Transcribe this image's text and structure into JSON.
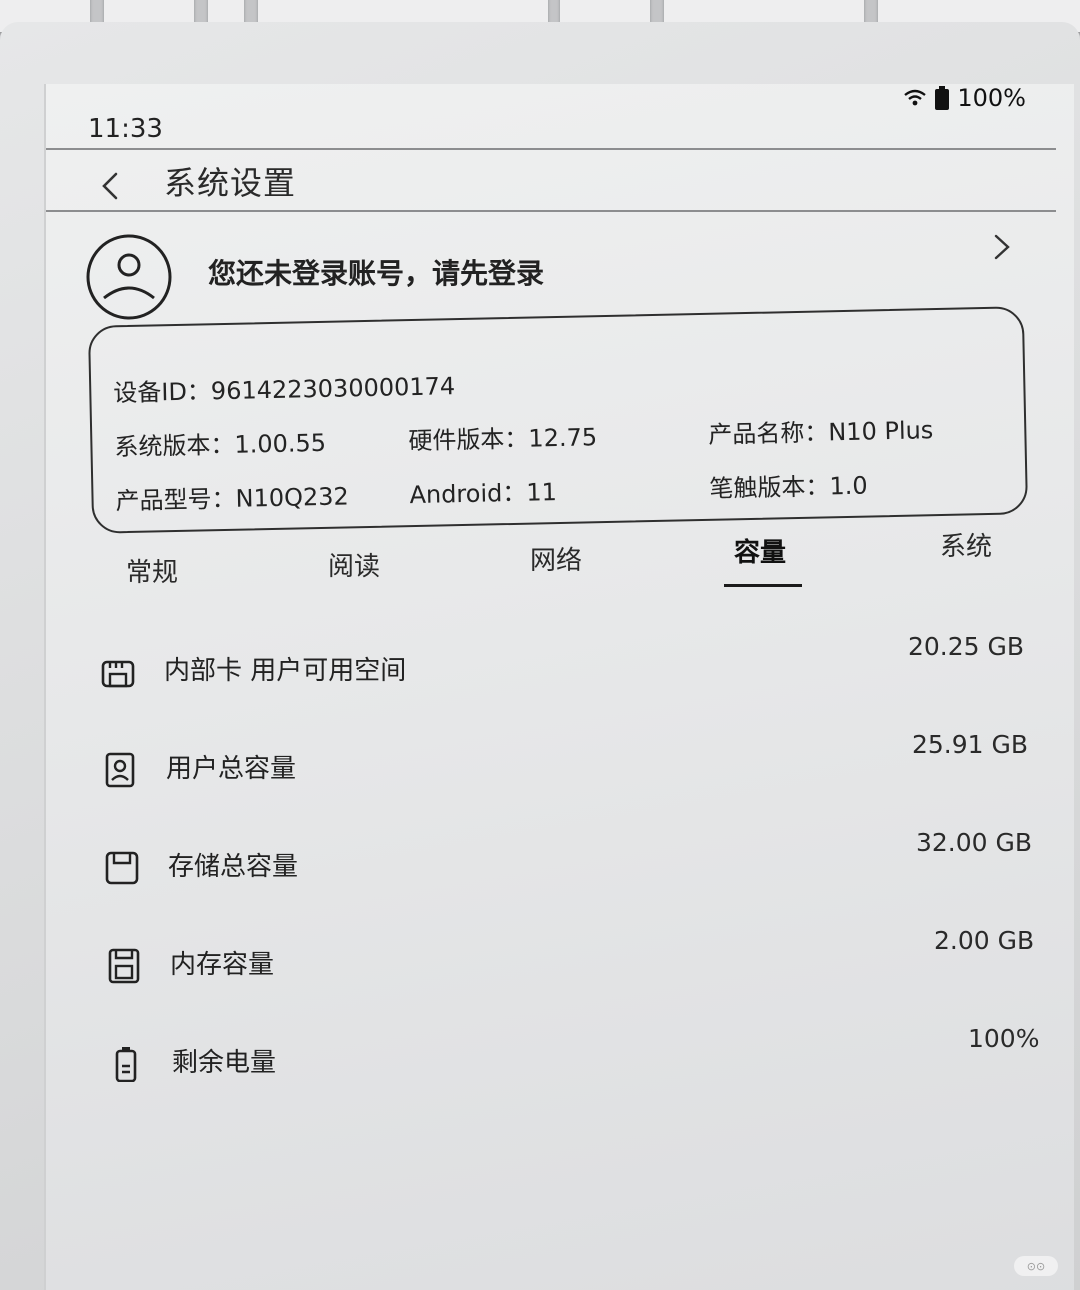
{
  "status_bar": {
    "time": "11:33",
    "battery": "100%"
  },
  "header": {
    "title": "系统设置"
  },
  "account": {
    "prompt": "您还未登录账号，请先登录"
  },
  "device_info": {
    "device_id": "设备ID：9614223030000174",
    "system_version": "系统版本：1.00.55",
    "hardware_version": "硬件版本：12.75",
    "product_name": "产品名称：N10 Plus",
    "product_model": "产品型号：N10Q232",
    "android": "Android：11",
    "pen_version": "笔触版本：1.0"
  },
  "tabs": [
    {
      "label": "常规"
    },
    {
      "label": "阅读"
    },
    {
      "label": "网络"
    },
    {
      "label": "容量"
    },
    {
      "label": "系统"
    }
  ],
  "active_tab": "容量",
  "capacity_rows": [
    {
      "label": "内部卡 用户可用空间",
      "value": "20.25 GB",
      "icon": "sd-card-icon"
    },
    {
      "label": "用户总容量",
      "value": "25.91 GB",
      "icon": "user-storage-icon"
    },
    {
      "label": "存储总容量",
      "value": "32.00 GB",
      "icon": "storage-icon"
    },
    {
      "label": "内存容量",
      "value": "2.00 GB",
      "icon": "memory-icon"
    },
    {
      "label": "剩余电量",
      "value": "100%",
      "icon": "battery-icon"
    }
  ]
}
